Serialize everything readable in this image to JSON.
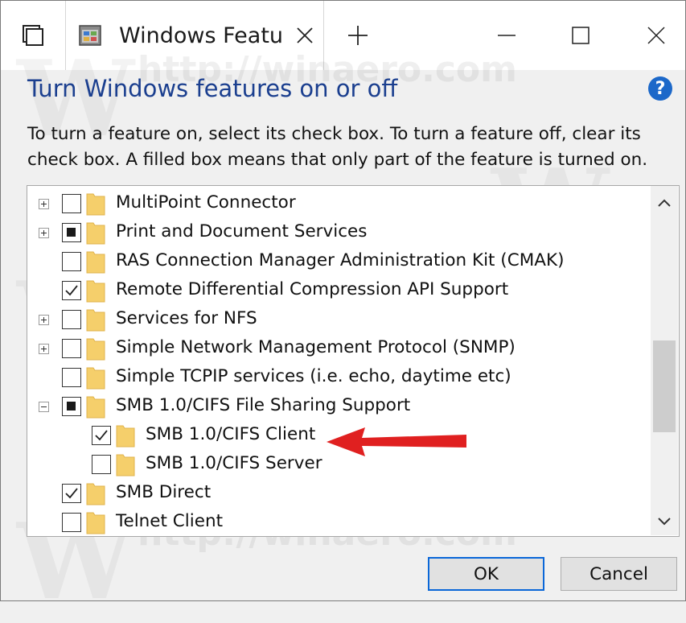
{
  "window": {
    "tab_title": "Windows Feature",
    "icons": {
      "tab_strip": "tab-strip-icon",
      "app": "windows-features-icon",
      "tab_close": "close-icon",
      "new_tab": "plus-icon",
      "minimize": "minimize-icon",
      "maximize": "maximize-icon",
      "close": "close-icon"
    }
  },
  "header": {
    "title": "Turn Windows features on or off",
    "help_icon": "?"
  },
  "description": "To turn a feature on, select its check box. To turn a feature off, clear its check box. A filled box means that only part of the feature is turned on.",
  "features": [
    {
      "label": "MultiPoint Connector",
      "state": "unchecked",
      "expander": "plus",
      "level": 0
    },
    {
      "label": "Print and Document Services",
      "state": "partial",
      "expander": "plus",
      "level": 0
    },
    {
      "label": "RAS Connection Manager Administration Kit (CMAK)",
      "state": "unchecked",
      "expander": "none",
      "level": 0
    },
    {
      "label": "Remote Differential Compression API Support",
      "state": "checked",
      "expander": "none",
      "level": 0
    },
    {
      "label": "Services for NFS",
      "state": "unchecked",
      "expander": "plus",
      "level": 0
    },
    {
      "label": "Simple Network Management Protocol (SNMP)",
      "state": "unchecked",
      "expander": "plus",
      "level": 0
    },
    {
      "label": "Simple TCPIP services (i.e. echo, daytime etc)",
      "state": "unchecked",
      "expander": "none",
      "level": 0
    },
    {
      "label": "SMB 1.0/CIFS File Sharing Support",
      "state": "partial",
      "expander": "minus",
      "level": 0
    },
    {
      "label": "SMB 1.0/CIFS Client",
      "state": "checked",
      "expander": "none",
      "level": 1
    },
    {
      "label": "SMB 1.0/CIFS Server",
      "state": "unchecked",
      "expander": "none",
      "level": 1
    },
    {
      "label": "SMB Direct",
      "state": "checked",
      "expander": "none",
      "level": 0
    },
    {
      "label": "Telnet Client",
      "state": "unchecked",
      "expander": "none",
      "level": 0
    }
  ],
  "scrollbar": {
    "up_icon": "chevron-up-icon",
    "down_icon": "chevron-down-icon"
  },
  "buttons": {
    "ok": "OK",
    "cancel": "Cancel"
  },
  "annotation": {
    "color": "#e02020",
    "icon": "red-arrow-left"
  },
  "watermark": {
    "text": "http://winaero.com"
  },
  "colors": {
    "title": "#1b3f8f",
    "help": "#1c68c9",
    "ok_border": "#0a67d8",
    "folder": "#f5cf6b"
  }
}
